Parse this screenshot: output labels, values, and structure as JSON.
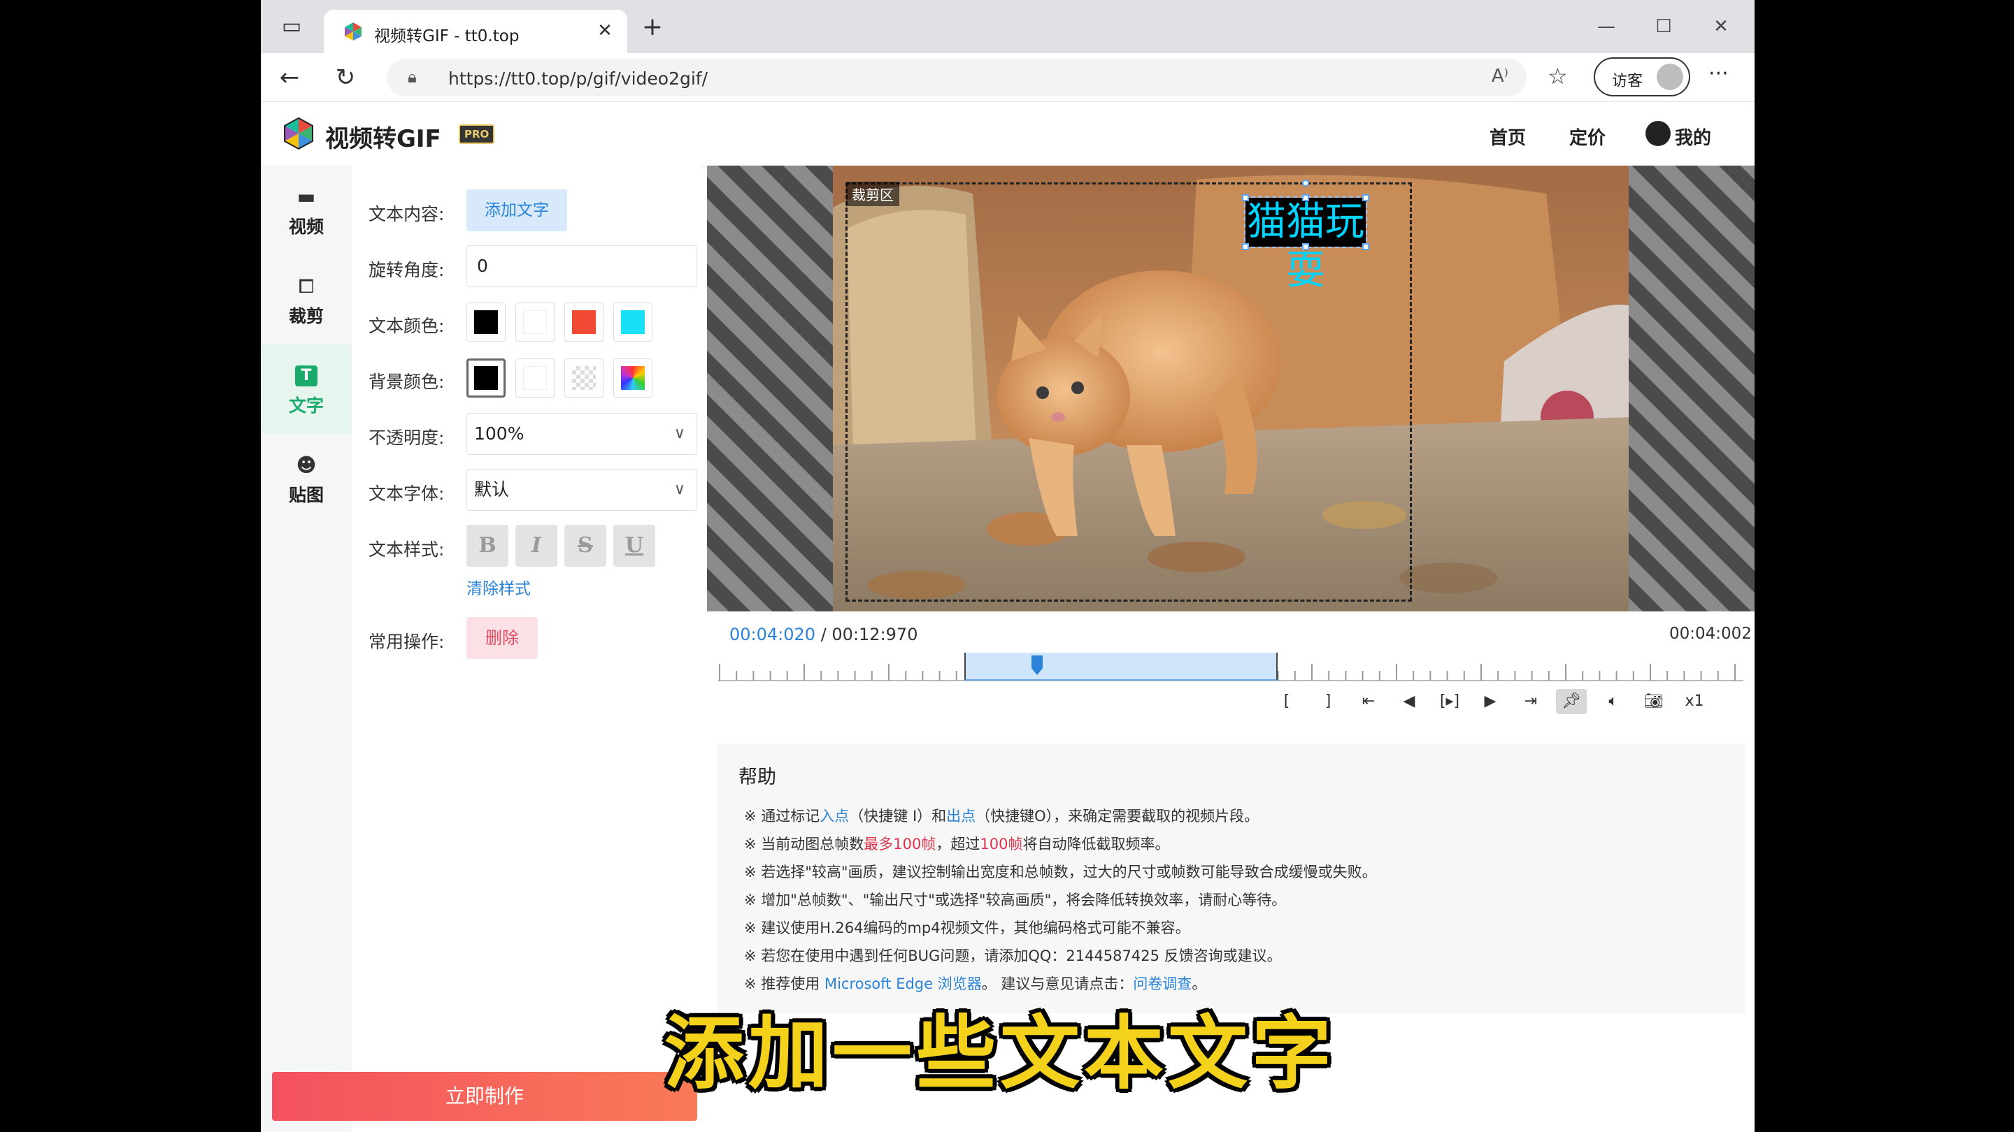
{
  "browser": {
    "tab_title": "视频转GIF - tt0.top",
    "url": "https://tt0.top/p/gif/video2gif/",
    "profile_label": "访客"
  },
  "header": {
    "brand": "视频转GIF",
    "pro_badge": "PRO",
    "nav": [
      "首页",
      "定价",
      "我的"
    ]
  },
  "leftnav": {
    "items": [
      {
        "label": "视频",
        "icon": "folder-icon"
      },
      {
        "label": "裁剪",
        "icon": "crop-icon"
      },
      {
        "label": "文字",
        "icon": "text-icon",
        "active": true
      },
      {
        "label": "贴图",
        "icon": "sticker-icon"
      }
    ]
  },
  "panel": {
    "text_content_label": "文本内容:",
    "add_text_button": "添加文字",
    "rotation_label": "旋转角度:",
    "rotation_value": "0",
    "text_color_label": "文本颜色:",
    "text_colors": [
      "#000000",
      "#ffffff",
      "#f24a35",
      "#19e0f5"
    ],
    "bg_color_label": "背景颜色:",
    "bg_colors": [
      "#000000",
      "#ffffff",
      "transparent",
      "rainbow"
    ],
    "opacity_label": "不透明度:",
    "opacity_value": "100%",
    "font_label": "文本字体:",
    "font_value": "默认",
    "style_label": "文本样式:",
    "style_buttons": [
      "B",
      "I",
      "S",
      "U"
    ],
    "clear_style": "清除样式",
    "common_ops_label": "常用操作:",
    "delete_button": "删除",
    "make_button": "立即制作"
  },
  "preview": {
    "crop_label": "裁剪区",
    "overlay_text": "猫猫玩耍"
  },
  "timeline": {
    "current_time": "00:04:020",
    "separator": " / ",
    "total_time": "00:12:970",
    "selection_duration": "00:04:002",
    "speed": "x1"
  },
  "help": {
    "title": "帮助",
    "lines": [
      {
        "parts": [
          "※ 通过标记",
          "入点",
          "（快捷键 I）和",
          "出点",
          "（快捷键O），来确定需要截取的视频片段。"
        ]
      },
      {
        "parts": [
          "※ 当前动图总帧数",
          "最多100帧",
          "，超过",
          "100帧",
          "将自动降低截取频率。"
        ]
      },
      {
        "text": "※ 若选择\"较高\"画质，建议控制输出宽度和总帧数，过大的尺寸或帧数可能导致合成缓慢或失败。"
      },
      {
        "text": "※ 增加\"总帧数\"、\"输出尺寸\"或选择\"较高画质\"，将会降低转换效率，请耐心等待。"
      },
      {
        "text": "※ 建议使用H.264编码的mp4视频文件，其他编码格式可能不兼容。"
      },
      {
        "text": "※ 若您在使用中遇到任何BUG问题，请添加QQ：2144587425 反馈咨询或建议。"
      },
      {
        "parts": [
          "※ 推荐使用 ",
          "Microsoft Edge 浏览器",
          "。 建议与意见请点击：",
          "问卷调查",
          "。"
        ]
      }
    ]
  },
  "subtitle": "添加一些文本文字"
}
